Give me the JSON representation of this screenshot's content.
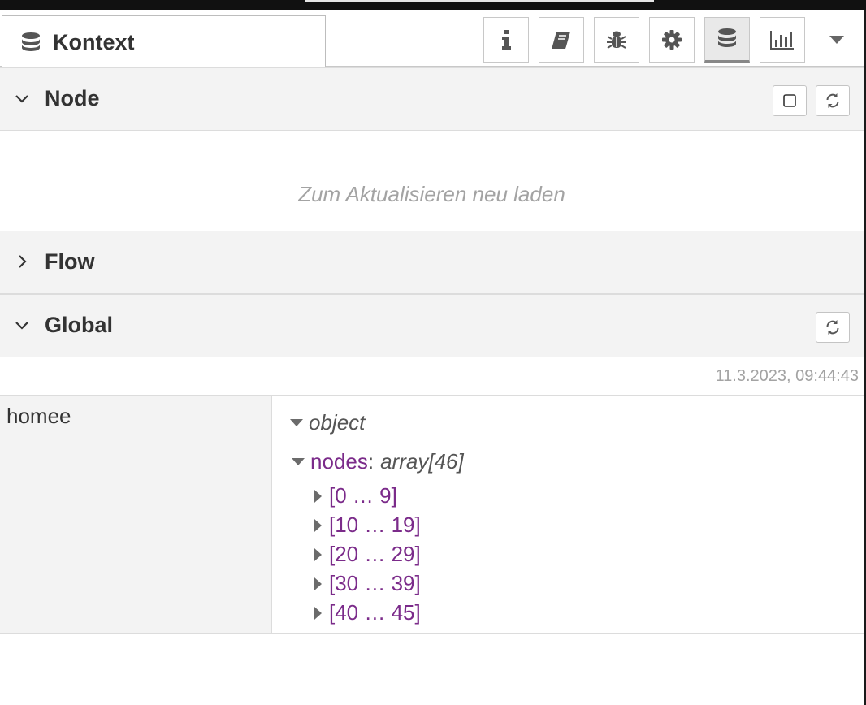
{
  "panel": {
    "tab_title": "Kontext",
    "tab_icon": "database-icon"
  },
  "toolbar": {
    "buttons": [
      {
        "name": "info",
        "icon": "info-icon"
      },
      {
        "name": "help",
        "icon": "book-icon"
      },
      {
        "name": "debug",
        "icon": "bug-icon"
      },
      {
        "name": "config",
        "icon": "gear-icon"
      },
      {
        "name": "context",
        "icon": "database-icon",
        "active": true
      },
      {
        "name": "dashboard",
        "icon": "bar-chart-icon"
      }
    ],
    "dropdown_icon": "caret-down-icon"
  },
  "sections": {
    "node": {
      "label": "Node",
      "expanded": true,
      "empty_message": "Zum Aktualisieren neu laden"
    },
    "flow": {
      "label": "Flow",
      "expanded": false
    },
    "global": {
      "label": "Global",
      "expanded": true,
      "timestamp": "11.3.2023, 09:44:43"
    }
  },
  "global_context": {
    "key": "homee",
    "value_type": "object",
    "property": {
      "name": "nodes",
      "separator": ":",
      "type": "array[46]",
      "ranges": [
        "[0 … 9]",
        "[10 … 19]",
        "[20 … 29]",
        "[30 … 39]",
        "[40 … 45]"
      ]
    }
  },
  "colors": {
    "key_purple": "#7b2b8a",
    "section_bg": "#f3f3f3",
    "muted_text": "#a3a3a3"
  }
}
